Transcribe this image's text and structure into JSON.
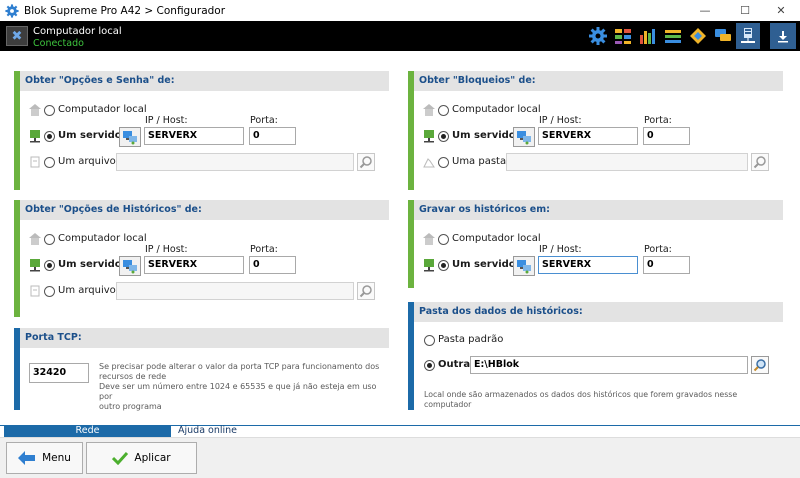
{
  "window": {
    "title": "Blok Supreme Pro A42 > Configurador"
  },
  "header": {
    "connection_name": "Computador local",
    "connection_status": "Conectado"
  },
  "panels": {
    "opcoes_senha": {
      "title": "Obter \"Opções e Senha\" de:",
      "local_label": "Computador local",
      "server_label": "Um servidor:",
      "file_label": "Um arquivo:",
      "ip_label": "IP / Host:",
      "port_label": "Porta:",
      "host_value": "SERVERX",
      "port_value": "0",
      "file_value": ""
    },
    "bloqueios": {
      "title": "Obter \"Bloqueios\" de:",
      "local_label": "Computador local",
      "server_label": "Um servidor:",
      "folder_label": "Uma pasta:",
      "ip_label": "IP / Host:",
      "port_label": "Porta:",
      "host_value": "SERVERX",
      "port_value": "0",
      "folder_value": ""
    },
    "opcoes_historicos": {
      "title": "Obter \"Opções de Históricos\" de:",
      "local_label": "Computador local",
      "server_label": "Um servidor:",
      "file_label": "Um arquivo:",
      "ip_label": "IP / Host:",
      "port_label": "Porta:",
      "host_value": "SERVERX",
      "port_value": "0",
      "file_value": ""
    },
    "gravar_historicos": {
      "title": "Gravar os históricos em:",
      "local_label": "Computador local",
      "server_label": "Um servidor:",
      "ip_label": "IP / Host:",
      "port_label": "Porta:",
      "host_value": "SERVERX",
      "port_value": "0"
    },
    "porta_tcp": {
      "title": "Porta TCP:",
      "port_value": "32420",
      "hint_lines": [
        "Se precisar pode alterar o valor da porta TCP para funcionamento dos",
        "recursos de rede",
        "Deve ser um número entre 1024 e 65535 e que já não esteja em uso por",
        "outro programa"
      ]
    },
    "pasta_dados": {
      "title": "Pasta dos dados de históricos:",
      "default_label": "Pasta padrão",
      "other_label": "Outra:",
      "other_value": "E:\\HBlok",
      "hint": "Local onde são armazenados os dados dos históricos que forem gravados nesse computador"
    }
  },
  "tabs": {
    "rede": "Rede",
    "ajuda": "Ajuda online"
  },
  "buttons": {
    "menu": "Menu",
    "aplicar": "Aplicar"
  },
  "colors": {
    "accent_blue": "#1c6aa8",
    "accent_green": "#6cb33f",
    "status_green": "#3ec43e"
  }
}
